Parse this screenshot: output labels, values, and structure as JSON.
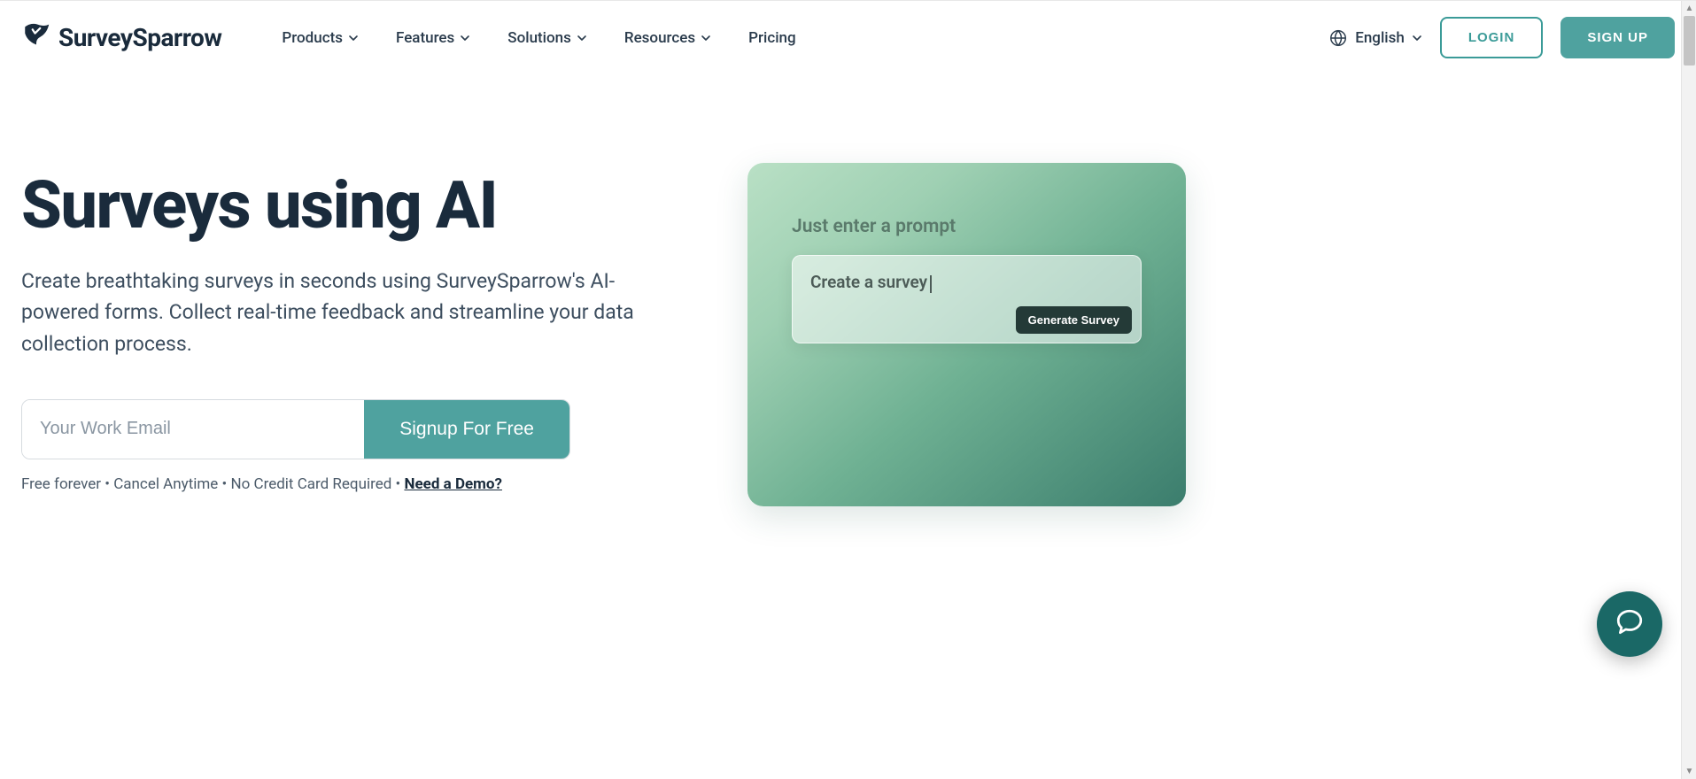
{
  "brand": "SurveySparrow",
  "nav": {
    "items": [
      {
        "label": "Products",
        "has_chevron": true
      },
      {
        "label": "Features",
        "has_chevron": true
      },
      {
        "label": "Solutions",
        "has_chevron": true
      },
      {
        "label": "Resources",
        "has_chevron": true
      },
      {
        "label": "Pricing",
        "has_chevron": false
      }
    ],
    "language": "English",
    "login": "LOGIN",
    "signup": "SIGN UP"
  },
  "hero": {
    "title": "Surveys using AI",
    "subtitle": "Create breathtaking surveys in seconds using SurveySparrow's AI-powered forms. Collect real-time feedback and streamline your data collection process.",
    "email_placeholder": "Your Work Email",
    "cta": "Signup For Free",
    "fineprint_prefix": "Free forever • Cancel Anytime • No Credit Card Required • ",
    "demo_link": "Need a Demo?"
  },
  "preview": {
    "label": "Just enter a prompt",
    "prompt_text": "Create a survey",
    "generate": "Generate Survey"
  },
  "colors": {
    "accent": "#4fa29f",
    "accent_dark": "#1a6866",
    "text": "#1a2b3c"
  }
}
